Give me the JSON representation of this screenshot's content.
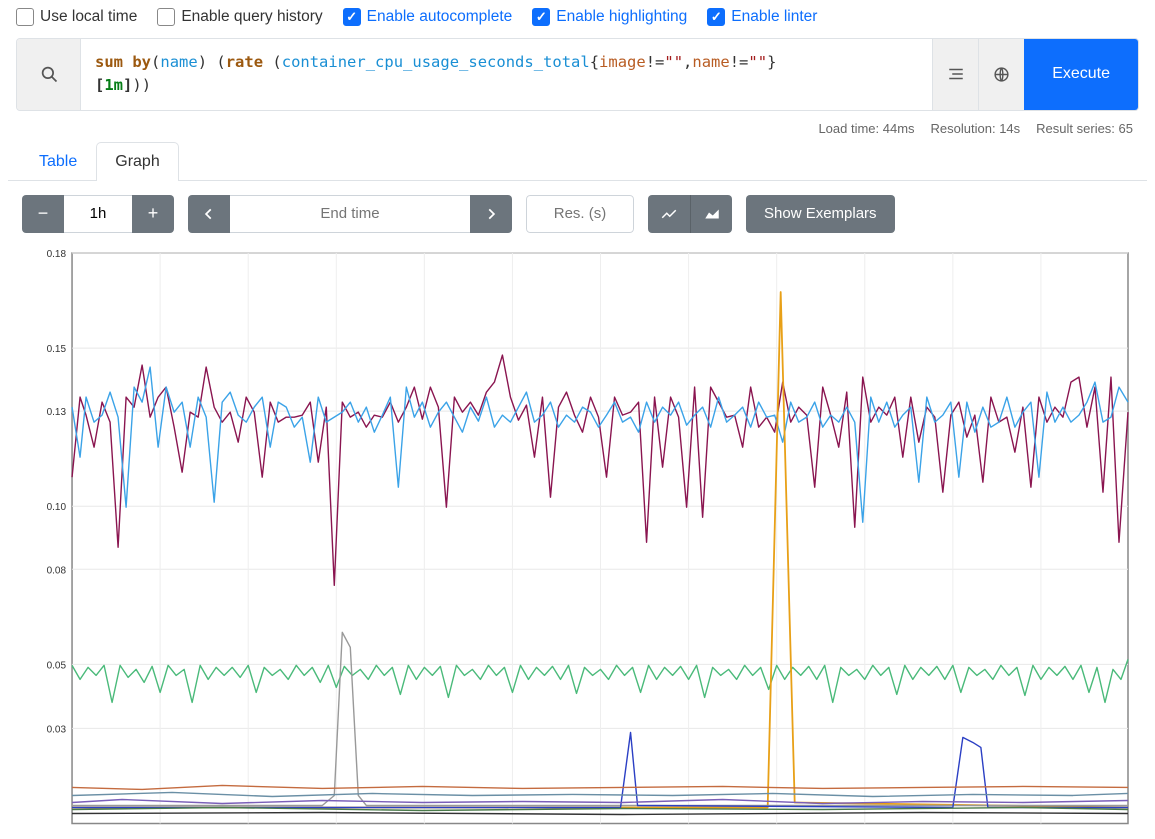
{
  "options": {
    "local_time": {
      "label": "Use local time",
      "checked": false
    },
    "query_history": {
      "label": "Enable query history",
      "checked": false
    },
    "autocomplete": {
      "label": "Enable autocomplete",
      "checked": true
    },
    "highlighting": {
      "label": "Enable highlighting",
      "checked": true
    },
    "linter": {
      "label": "Enable linter",
      "checked": true
    }
  },
  "query": {
    "raw": "sum by(name) (rate (container_cpu_usage_seconds_total{image!=\"\",name!=\"\"}[1m]))",
    "tokens": {
      "sum": "sum",
      "by": "by",
      "name": "name",
      "rate": "rate",
      "metric": "container_cpu_usage_seconds_total",
      "label1": "image",
      "label2": "name",
      "ne": "!=",
      "qq": "\"\"",
      "lb": "[",
      "rb": "]",
      "dur": "1m",
      "lp": "(",
      "rp": ")",
      "cm": ",",
      "lc": "{",
      "rc": "}"
    }
  },
  "exec": {
    "label": "Execute"
  },
  "meta": {
    "load_time": "Load time: 44ms",
    "resolution": "Resolution: 14s",
    "series": "Result series: 65"
  },
  "tabs": {
    "table": "Table",
    "graph": "Graph"
  },
  "controls": {
    "range": "1h",
    "end_time_placeholder": "End time",
    "res_placeholder": "Res. (s)",
    "exemplars": "Show Exemplars"
  },
  "chart_data": {
    "type": "line",
    "ylim": [
      0.0,
      0.18
    ],
    "yticks": [
      0.03,
      0.05,
      0.08,
      0.1,
      0.13,
      0.15,
      0.18
    ],
    "x_range_minutes": 60,
    "series_description": "65 time series of container CPU usage rate; two dominant noisy series around 0.12-0.14 (blue, maroon), one mid series around 0.045-0.055 (green), one orange spike near right rising to ~0.16, many low-value series clustered near 0.01-0.02."
  }
}
